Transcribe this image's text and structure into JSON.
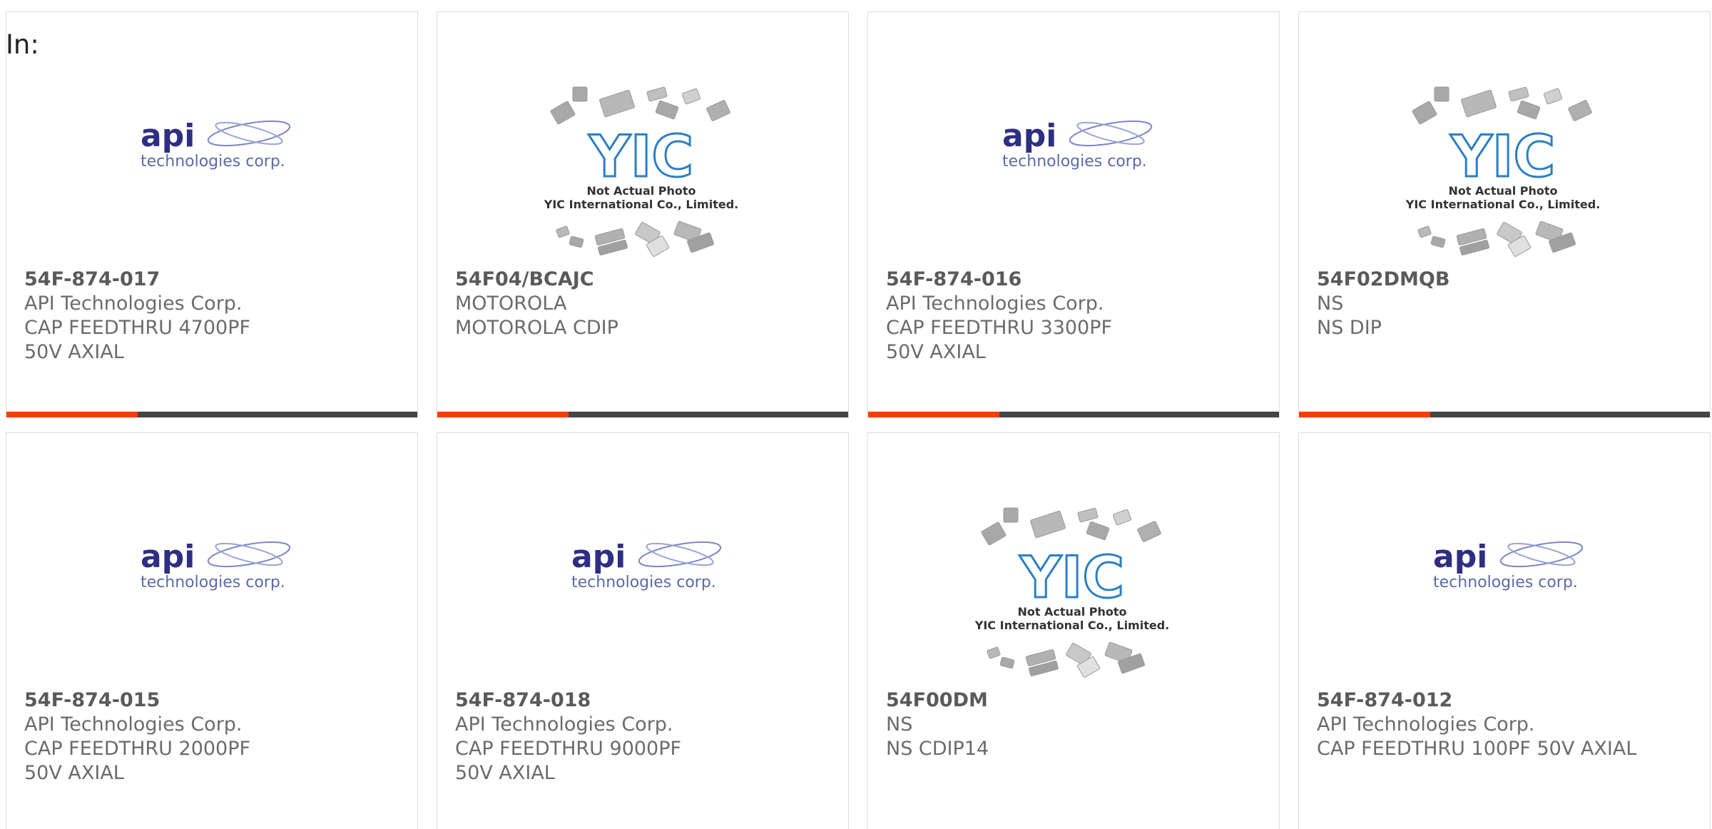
{
  "filter_label": "In:",
  "colors": {
    "accent": "#ff3d00",
    "bar_track": "#444444",
    "api_logo": "#2e2e83",
    "yic_logo": "#2b7fc4"
  },
  "logos": {
    "api": {
      "name": "api",
      "sub": "technologies corp."
    },
    "yic": {
      "name": "YIC",
      "line1": "Not Actual Photo",
      "line2": "YIC International Co., Limited."
    }
  },
  "products": [
    {
      "part": "54F-874-017",
      "maker": "API Technologies Corp.",
      "desc": "CAP FEEDTHRU 4700PF 50V AXIAL",
      "logo": "api",
      "progress": 0.32
    },
    {
      "part": "54F04/BCAJC",
      "maker": "MOTOROLA",
      "desc": "MOTOROLA CDIP",
      "logo": "yic",
      "progress": 0.32
    },
    {
      "part": "54F-874-016",
      "maker": "API Technologies Corp.",
      "desc": "CAP FEEDTHRU 3300PF 50V AXIAL",
      "logo": "api",
      "progress": 0.32
    },
    {
      "part": "54F02DMQB",
      "maker": "NS",
      "desc": "NS DIP",
      "logo": "yic",
      "progress": 0.32
    },
    {
      "part": "54F-874-015",
      "maker": "API Technologies Corp.",
      "desc": "CAP FEEDTHRU 2000PF 50V AXIAL",
      "logo": "api",
      "progress": null
    },
    {
      "part": "54F-874-018",
      "maker": "API Technologies Corp.",
      "desc": "CAP FEEDTHRU 9000PF 50V AXIAL",
      "logo": "api",
      "progress": null
    },
    {
      "part": "54F00DM",
      "maker": "NS",
      "desc": "NS CDIP14",
      "logo": "yic",
      "progress": null
    },
    {
      "part": "54F-874-012",
      "maker": "API Technologies Corp.",
      "desc": "CAP FEEDTHRU 100PF 50V AXIAL",
      "logo": "api",
      "progress": null
    }
  ]
}
